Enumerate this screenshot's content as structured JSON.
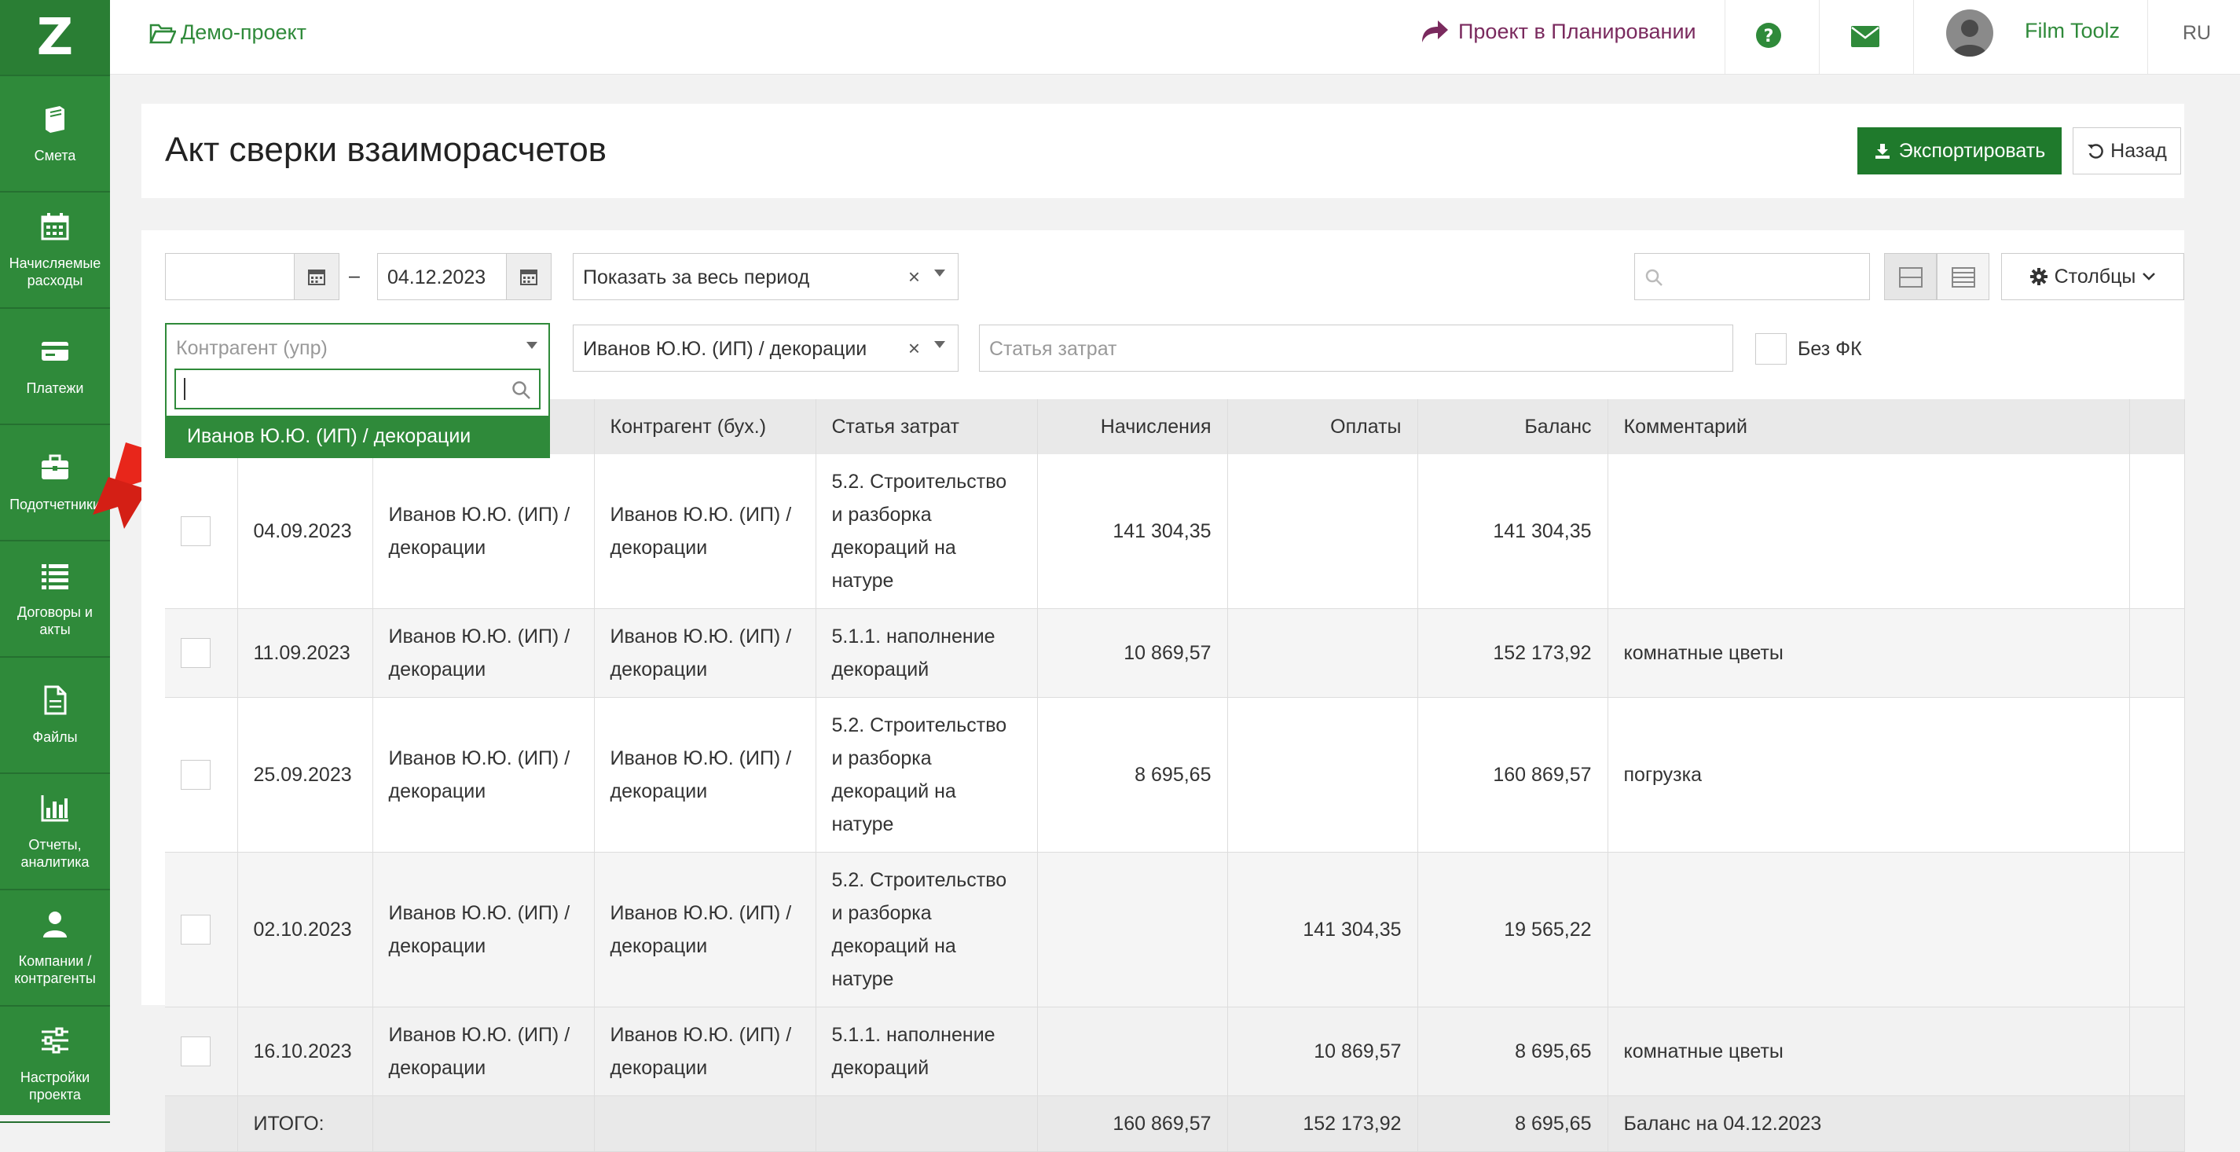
{
  "topbar": {
    "project": "Демо-проект",
    "planning": "Проект в Планировании",
    "user": "Film Toolz",
    "lang": "RU"
  },
  "sidebar": {
    "logo": "Z",
    "items": [
      {
        "label": "Смета",
        "icon": "book-icon"
      },
      {
        "label": "Начисляемые расходы",
        "icon": "calendar-icon"
      },
      {
        "label": "Платежи",
        "icon": "card-icon"
      },
      {
        "label": "Подотчетники",
        "icon": "briefcase-icon"
      },
      {
        "label": "Договоры и акты",
        "icon": "list-icon"
      },
      {
        "label": "Файлы",
        "icon": "file-icon"
      },
      {
        "label": "Отчеты, аналитика",
        "icon": "bar-chart-icon"
      },
      {
        "label": "Компании / контрагенты",
        "icon": "user-icon"
      },
      {
        "label": "Настройки проекта",
        "icon": "sliders-icon"
      }
    ]
  },
  "page": {
    "title": "Акт сверки взаиморасчетов",
    "export_label": "Экспортировать",
    "back_label": "Назад"
  },
  "filters": {
    "date_from": "",
    "date_sep": "–",
    "date_to": "04.12.2023",
    "period": "Показать за весь период",
    "columns_label": "Столбцы",
    "counterparty_mgmt_placeholder": "Контрагент (упр)",
    "counterparty_acc": "Иванов Ю.Ю. (ИП) / декорации",
    "cost_item_placeholder": "Статья затрат",
    "no_fk_label": "Без ФК"
  },
  "dropdown": {
    "search_value": "",
    "option": "Иванов Ю.Ю. (ИП) / декорации"
  },
  "table": {
    "headers": [
      "",
      "",
      "",
      "Контрагент (бух.)",
      "Статья затрат",
      "Начисления",
      "Оплаты",
      "Баланс",
      "Комментарий",
      ""
    ],
    "rows": [
      {
        "date": "04.09.2023",
        "cp_mgmt": "Иванов Ю.Ю. (ИП) / декорации",
        "cp_acc": "Иванов Ю.Ю. (ИП) / декорации",
        "item": "5.2. Строительство и разборка декораций на натуре",
        "accrual": "141 304,35",
        "payment": "",
        "balance": "141 304,35",
        "comment": ""
      },
      {
        "date": "11.09.2023",
        "cp_mgmt": "Иванов Ю.Ю. (ИП) / декорации",
        "cp_acc": "Иванов Ю.Ю. (ИП) / декорации",
        "item": "5.1.1. наполнение декораций",
        "accrual": "10 869,57",
        "payment": "",
        "balance": "152 173,92",
        "comment": "комнатные цветы"
      },
      {
        "date": "25.09.2023",
        "cp_mgmt": "Иванов Ю.Ю. (ИП) / декорации",
        "cp_acc": "Иванов Ю.Ю. (ИП) / декорации",
        "item": "5.2. Строительство и разборка декораций на натуре",
        "accrual": "8 695,65",
        "payment": "",
        "balance": "160 869,57",
        "comment": "погрузка"
      },
      {
        "date": "02.10.2023",
        "cp_mgmt": "Иванов Ю.Ю. (ИП) / декорации",
        "cp_acc": "Иванов Ю.Ю. (ИП) / декорации",
        "item": "5.2. Строительство и разборка декораций на натуре",
        "accrual": "",
        "payment": "141 304,35",
        "balance": "19 565,22",
        "comment": ""
      },
      {
        "date": "16.10.2023",
        "cp_mgmt": "Иванов Ю.Ю. (ИП) / декорации",
        "cp_acc": "Иванов Ю.Ю. (ИП) / декорации",
        "item": "5.1.1. наполнение декораций",
        "accrual": "",
        "payment": "10 869,57",
        "balance": "8 695,65",
        "comment": "комнатные цветы"
      }
    ],
    "total": {
      "label": "ИТОГО:",
      "accrual": "160 869,57",
      "payment": "152 173,92",
      "balance": "8 695,65",
      "comment": "Баланс на 04.12.2023"
    }
  },
  "colors": {
    "brand_green": "#2f8a3a",
    "export_green": "#1f7a2c",
    "planning_purple": "#7a2a5e"
  }
}
